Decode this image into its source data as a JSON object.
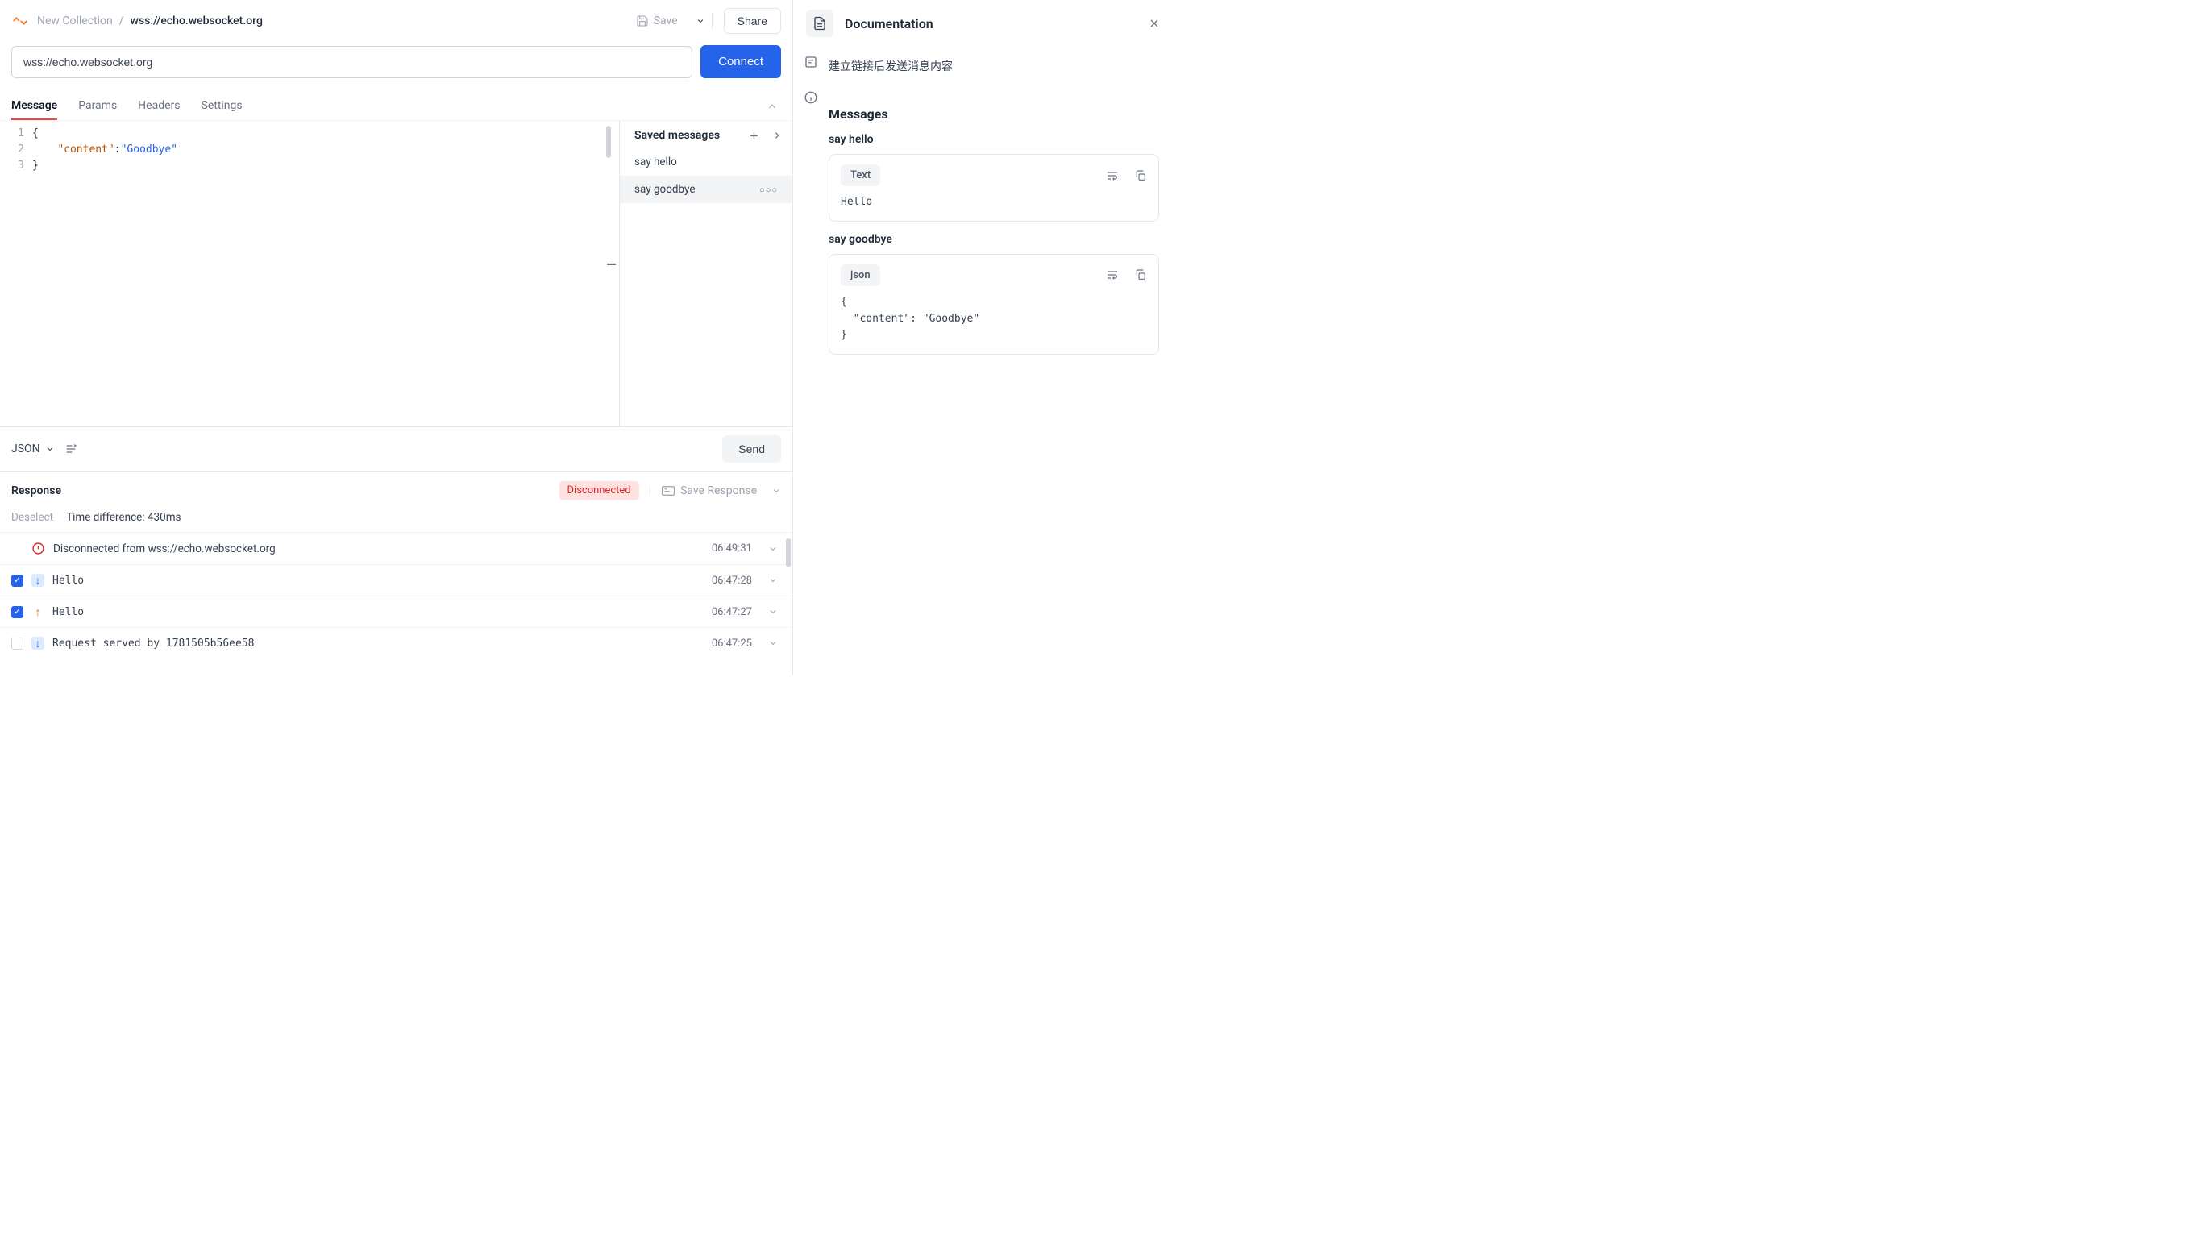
{
  "header": {
    "collection": "New Collection",
    "title": "wss://echo.websocket.org",
    "save": "Save",
    "share": "Share"
  },
  "url": {
    "value": "wss://echo.websocket.org",
    "connect": "Connect"
  },
  "tabs": [
    "Message",
    "Params",
    "Headers",
    "Settings"
  ],
  "editor": {
    "lines": [
      "1",
      "2",
      "3"
    ],
    "code_l1": "{",
    "code_l2_key": "\"content\"",
    "code_l2_colon": ":",
    "code_l2_val": "\"Goodbye\"",
    "code_l3": "}"
  },
  "saved_messages": {
    "title": "Saved messages",
    "items": [
      "say hello",
      "say goodbye"
    ]
  },
  "editor_footer": {
    "format": "JSON",
    "send": "Send"
  },
  "response": {
    "title": "Response",
    "status": "Disconnected",
    "save_response": "Save Response",
    "deselect": "Deselect",
    "time_diff": "Time difference: 430ms"
  },
  "logs": [
    {
      "type": "alert",
      "text": "Disconnected from wss://echo.websocket.org",
      "time": "06:49:31",
      "checked": false,
      "mono": false
    },
    {
      "type": "incoming",
      "text": "Hello",
      "time": "06:47:28",
      "checked": true,
      "mono": true
    },
    {
      "type": "outgoing",
      "text": "Hello",
      "time": "06:47:27",
      "checked": true,
      "mono": true
    },
    {
      "type": "incoming",
      "text": "Request served by 1781505b56ee58",
      "time": "06:47:25",
      "checked": false,
      "mono": true
    }
  ],
  "doc": {
    "title": "Documentation",
    "description": "建立链接后发送消息内容",
    "messages_heading": "Messages",
    "blocks": [
      {
        "title": "say hello",
        "type": "Text",
        "body": "Hello"
      },
      {
        "title": "say goodbye",
        "type": "json",
        "body": "{\n  \"content\": \"Goodbye\"\n}"
      }
    ]
  }
}
